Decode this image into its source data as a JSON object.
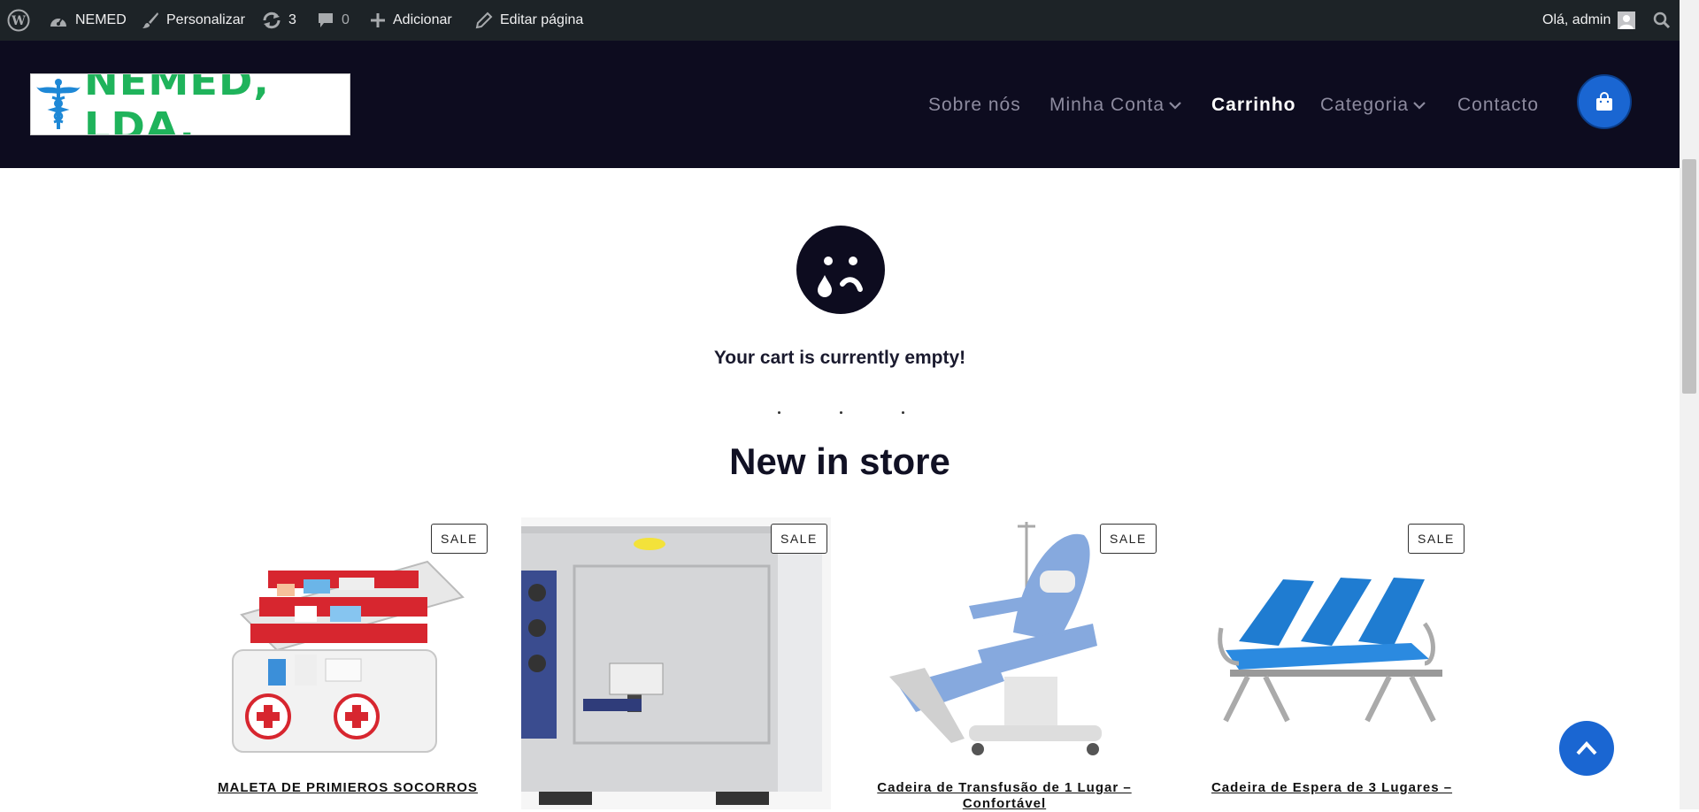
{
  "admin_bar": {
    "site_name": "NEMED",
    "customize": "Personalizar",
    "updates_count": "3",
    "comments_count": "0",
    "add_new": "Adicionar",
    "edit_page": "Editar página",
    "greeting": "Olá, admin"
  },
  "header": {
    "logo_text": "NEMED, LDA.",
    "nav": [
      {
        "label": "Sobre nós"
      },
      {
        "label": "Minha Conta"
      },
      {
        "label": "Carrinho"
      },
      {
        "label": "Categoria"
      },
      {
        "label": "Contacto"
      }
    ]
  },
  "cart": {
    "empty_message": "Your cart is currently empty!"
  },
  "new_in_store": {
    "heading": "New in store",
    "sale_label": "SALE",
    "products": [
      {
        "title": "MALETA DE PRIMIEROS SOCORROS"
      },
      {
        "title": ""
      },
      {
        "title": "Cadeira de Transfusão de 1 Lugar – Confortável"
      },
      {
        "title": "Cadeira de Espera de 3 Lugares –"
      }
    ]
  },
  "colors": {
    "header_bg": "#0d0c1f",
    "accent": "#1a66d2",
    "admin_bar_bg": "#1d2327"
  }
}
